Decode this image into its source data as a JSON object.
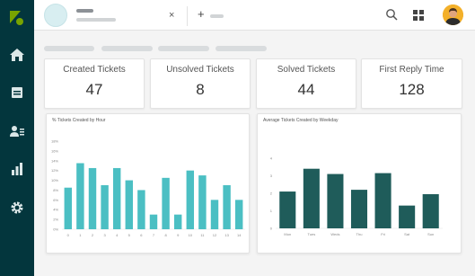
{
  "sidebar": {
    "logo": "zendesk-logo",
    "items": [
      {
        "icon": "home-icon"
      },
      {
        "icon": "views-icon"
      },
      {
        "icon": "customers-icon"
      },
      {
        "icon": "reporting-icon"
      },
      {
        "icon": "admin-gear-icon"
      }
    ],
    "colors": {
      "background": "#03363d",
      "icon": "#dbe7e8",
      "logo": "#78a300"
    }
  },
  "topbar": {
    "tab": {
      "close_label": "×"
    },
    "add_tab_label": "+",
    "search_icon": "search-icon",
    "apps_icon": "apps-grid-icon"
  },
  "kpis": [
    {
      "label": "Created Tickets",
      "value": "47"
    },
    {
      "label": "Unsolved Tickets",
      "value": "8"
    },
    {
      "label": "Solved Tickets",
      "value": "44"
    },
    {
      "label": "First Reply Time",
      "value": "128"
    }
  ],
  "chart_data": [
    {
      "type": "bar",
      "title": "% Tickets Created by Hour",
      "xlabel": "",
      "ylabel": "",
      "categories": [
        "0",
        "1",
        "2",
        "3",
        "4",
        "5",
        "6",
        "7",
        "8",
        "9",
        "10",
        "11",
        "12",
        "13",
        "14"
      ],
      "values": [
        8.5,
        13.5,
        12.5,
        9,
        12.5,
        10,
        8,
        3,
        10.5,
        3,
        12,
        11,
        6,
        9,
        6
      ],
      "y_ticks": [
        "0%",
        "2%",
        "4%",
        "6%",
        "8%",
        "10%",
        "12%",
        "14%",
        "16%",
        "18%"
      ],
      "ylim": [
        0,
        18
      ],
      "color": "#4bbfc3",
      "grid": true
    },
    {
      "type": "bar",
      "title": "Average Tickets Created by Weekday",
      "xlabel": "",
      "ylabel": "",
      "categories": [
        "Mon",
        "Tues",
        "Weds",
        "Thu",
        "Fri",
        "Sat",
        "Sun"
      ],
      "values": [
        2.1,
        3.4,
        3.1,
        2.2,
        3.15,
        1.3,
        1.95
      ],
      "y_ticks": [
        "0",
        "1",
        "2",
        "3",
        "4"
      ],
      "ylim": [
        0,
        4
      ],
      "color": "#1f5c5a",
      "grid": true
    }
  ]
}
